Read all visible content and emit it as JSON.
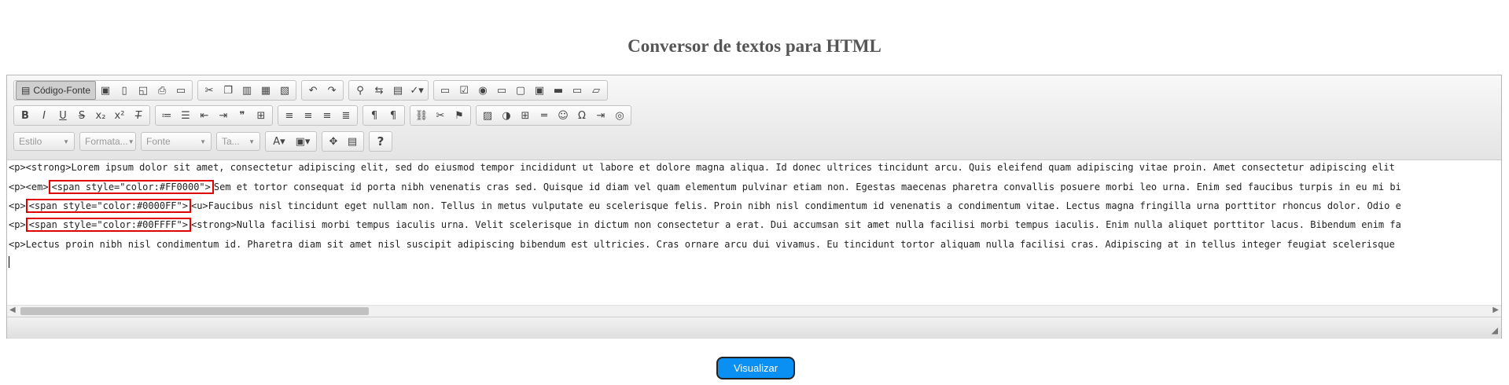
{
  "page": {
    "title": "Conversor de textos para HTML"
  },
  "toolbar": {
    "source_label": "Código-Fonte",
    "styles_placeholder": "Estilo",
    "format_placeholder": "Formata...",
    "font_placeholder": "Fonte",
    "size_placeholder": "Ta...",
    "help_label": "?"
  },
  "content": {
    "lines": [
      {
        "text": "<p><strong>Lorem ipsum dolor sit amet, consectetur adipiscing elit, sed do eiusmod tempor incididunt ut labore et dolore magna aliqua. Id donec ultrices tincidunt arcu. Quis eleifend quam adipiscing vitae proin. Amet consectetur adipiscing elit"
      },
      {
        "prefix": "<p><em>",
        "highlight": "<span style=\"color:#FF0000\">",
        "rest": "Sem et tortor consequat id porta nibh venenatis cras sed. Quisque id diam vel quam elementum pulvinar etiam non. Egestas maecenas pharetra convallis posuere morbi leo urna. Enim sed faucibus turpis in eu mi bi"
      },
      {
        "prefix": "<p>",
        "highlight": "<span style=\"color:#0000FF\">",
        "rest": "<u>Faucibus nisl tincidunt eget nullam non. Tellus in metus vulputate eu scelerisque felis. Proin nibh nisl condimentum id venenatis a condimentum vitae. Lectus magna fringilla urna porttitor rhoncus dolor. Odio e"
      },
      {
        "prefix": "<p>",
        "highlight": "<span style=\"color:#00FFFF\">",
        "rest": "<strong>Nulla facilisi morbi tempus iaculis urna. Velit scelerisque in dictum non consectetur a erat. Dui accumsan sit amet nulla facilisi morbi tempus iaculis. Enim nulla aliquet porttitor lacus. Bibendum enim fa"
      },
      {
        "text": "<p>Lectus proin nibh nisl condimentum id. Pharetra diam sit amet nisl suscipit adipiscing bibendum est ultricies. Cras ornare arcu dui vivamus. Eu tincidunt tortor aliquam nulla facilisi cras. Adipiscing at in tellus integer feugiat scelerisque"
      }
    ]
  },
  "actions": {
    "view_label": "Visualizar"
  },
  "colors": {
    "accent": "#0a8ff2",
    "highlight_border": "#e00000"
  }
}
